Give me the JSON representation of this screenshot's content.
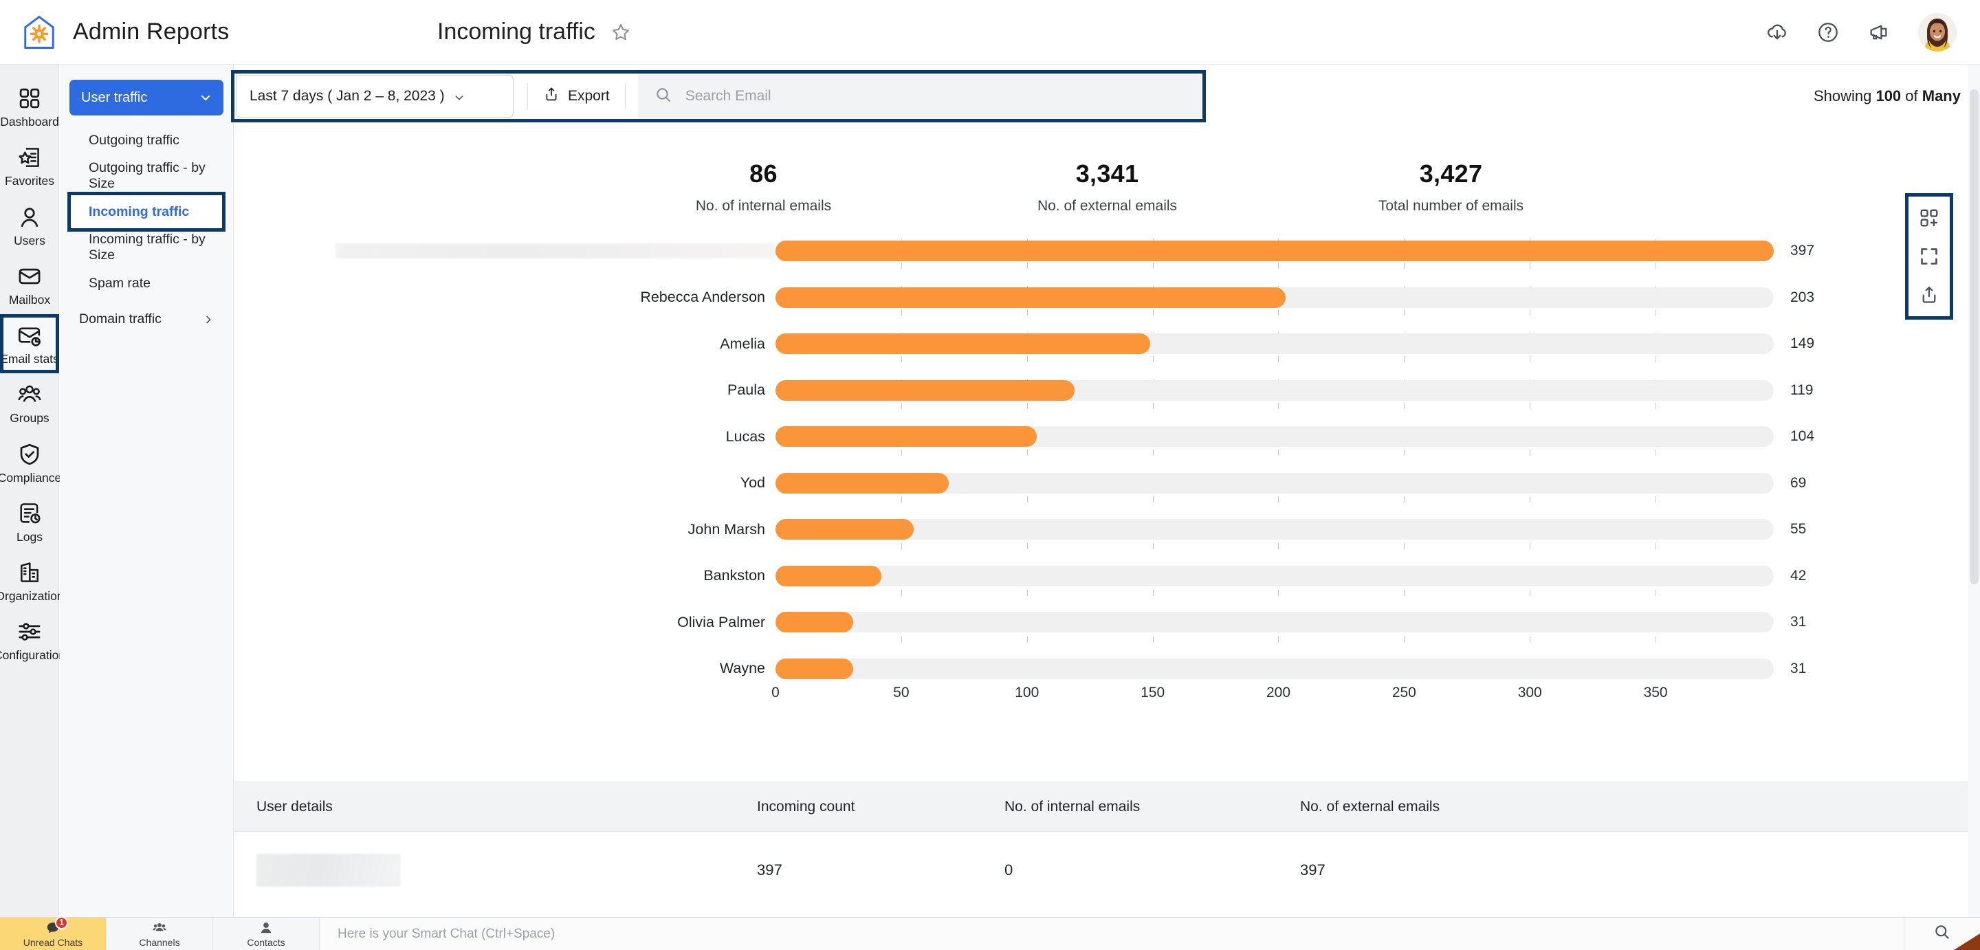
{
  "app": {
    "brand_title": "Admin Reports",
    "logo_icon": "house-gear-icon"
  },
  "header": {
    "page_title": "Incoming traffic",
    "favorite_icon": "star-icon",
    "actions": [
      {
        "icon": "download-cloud-icon",
        "name": "downloads"
      },
      {
        "icon": "help-circle-icon",
        "name": "help"
      },
      {
        "icon": "megaphone-icon",
        "name": "announcements"
      }
    ],
    "avatar_icon": "user-avatar-photo"
  },
  "rail": {
    "items": [
      {
        "label": "Dashboard",
        "icon": "grid-icon",
        "highlighted": false
      },
      {
        "label": "Favorites",
        "icon": "star-document-icon",
        "highlighted": false
      },
      {
        "label": "Users",
        "icon": "user-icon",
        "highlighted": false
      },
      {
        "label": "Mailbox",
        "icon": "envelope-icon",
        "highlighted": false
      },
      {
        "label": "Email stats",
        "icon": "envelope-chart-icon",
        "highlighted": true
      },
      {
        "label": "Groups",
        "icon": "people-group-icon",
        "highlighted": false
      },
      {
        "label": "Compliance",
        "icon": "shield-check-icon",
        "highlighted": false
      },
      {
        "label": "Logs",
        "icon": "document-clock-icon",
        "highlighted": false
      },
      {
        "label": "Organization",
        "icon": "building-icon",
        "highlighted": false
      },
      {
        "label": "Configuration",
        "icon": "sliders-icon",
        "highlighted": false
      }
    ]
  },
  "subnav": {
    "group_label": "User traffic",
    "group_chevron": "chevron-down-icon",
    "items": [
      {
        "label": "Outgoing traffic",
        "active": false,
        "highlighted": false,
        "has_children": false
      },
      {
        "label": "Outgoing traffic - by Size",
        "active": false,
        "highlighted": false,
        "has_children": false
      },
      {
        "label": "Incoming traffic",
        "active": true,
        "highlighted": true,
        "has_children": false
      },
      {
        "label": "Incoming traffic - by Size",
        "active": false,
        "highlighted": false,
        "has_children": false
      },
      {
        "label": "Spam rate",
        "active": false,
        "highlighted": false,
        "has_children": false
      },
      {
        "label": "Domain traffic",
        "active": false,
        "highlighted": false,
        "has_children": true
      }
    ],
    "child_chevron": "chevron-right-icon"
  },
  "toolbar": {
    "date_range": "Last 7 days ( Jan 2 – 8, 2023 )",
    "date_chevron": "chevron-down-icon",
    "export_label": "Export",
    "export_icon": "share-upload-icon",
    "search_icon": "search-icon",
    "search_value": "",
    "search_placeholder": "Search Email",
    "showing_prefix": "Showing ",
    "showing_count": "100",
    "showing_middle": " of ",
    "showing_total": "Many",
    "highlighted": true
  },
  "kpis": [
    {
      "value": "86",
      "label": "No. of internal emails"
    },
    {
      "value": "3,341",
      "label": "No. of external emails"
    },
    {
      "value": "3,427",
      "label": "Total number of emails"
    }
  ],
  "chart_tools": [
    {
      "icon": "add-to-dashboard-icon",
      "name": "add-to-dashboard"
    },
    {
      "icon": "fullscreen-icon",
      "name": "fullscreen"
    },
    {
      "icon": "share-upload-icon",
      "name": "share"
    }
  ],
  "chart_data": {
    "type": "bar",
    "orientation": "horizontal",
    "title": "Incoming traffic",
    "xlabel": "",
    "ylabel": "",
    "xlim": [
      0,
      397
    ],
    "grid": true,
    "legend": null,
    "tick_labels": [
      "0",
      "50",
      "100",
      "150",
      "200",
      "250",
      "300",
      "350"
    ],
    "tick_values": [
      0,
      50,
      100,
      150,
      200,
      250,
      300,
      350
    ],
    "categories": [
      "",
      "Rebecca Anderson",
      "Amelia",
      "Paula",
      "Lucas",
      "Yod",
      "John Marsh",
      "Bankston",
      "Olivia Palmer",
      "Wayne"
    ],
    "redacted_categories": [
      0
    ],
    "values": [
      397,
      203,
      149,
      119,
      104,
      69,
      55,
      42,
      31,
      31
    ],
    "value_labels": [
      "397",
      "203",
      "149",
      "119",
      "104",
      "69",
      "55",
      "42",
      "31",
      "31"
    ],
    "bar_color": "#fb9539",
    "track_color": "#f0f0f1"
  },
  "table": {
    "columns": [
      "User details",
      "Incoming count",
      "No. of internal emails",
      "No. of external emails"
    ],
    "rows": [
      {
        "user": "",
        "user_redacted": true,
        "incoming": "397",
        "internal": "0",
        "external": "397"
      }
    ]
  },
  "chatbar": {
    "tabs": [
      {
        "label": "Unread Chats",
        "icon": "chat-bubble-icon",
        "badge": "1",
        "accent": true
      },
      {
        "label": "Channels",
        "icon": "people-group-icon",
        "badge": "",
        "accent": false
      },
      {
        "label": "Contacts",
        "icon": "user-icon",
        "badge": "",
        "accent": false
      }
    ],
    "input_placeholder": "Here is your Smart Chat (Ctrl+Space)",
    "input_value": "",
    "search_icon": "search-icon"
  },
  "colors": {
    "accent_blue": "#2f6be0",
    "highlight_navy": "#0b3a66",
    "bar_orange": "#fb9539",
    "badge_red": "#e0312b",
    "chat_accent": "#fbd775"
  }
}
